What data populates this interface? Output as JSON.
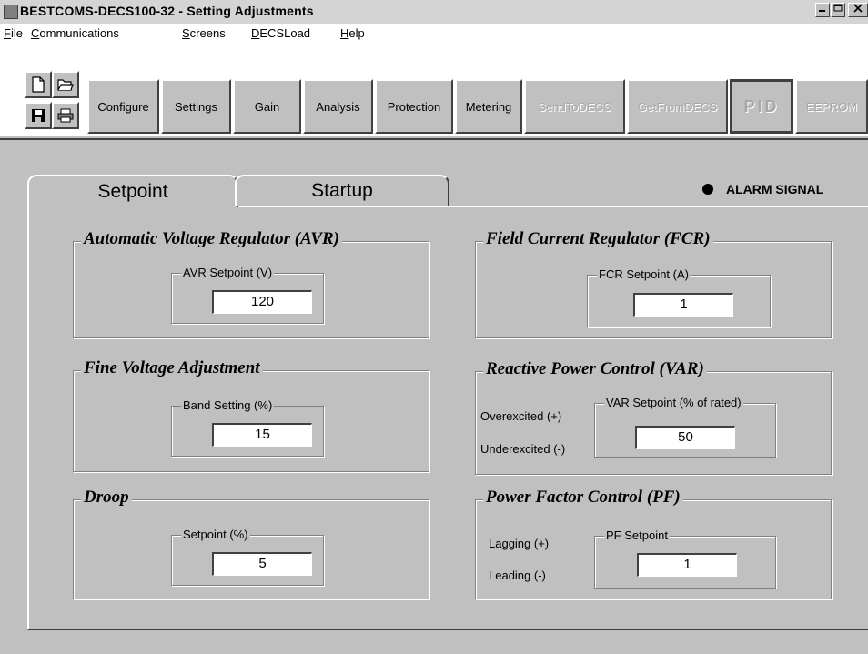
{
  "window": {
    "title": "BESTCOMS-DECS100-32 - Setting Adjustments"
  },
  "menu": [
    {
      "label": "File",
      "underline": "F",
      "rest": "ile"
    },
    {
      "label": "Communications",
      "underline": "C",
      "rest": "ommunications"
    },
    {
      "label": "Screens",
      "underline": "S",
      "rest": "creens"
    },
    {
      "label": "DECSLoad",
      "underline": "D",
      "rest": "ECSLoad"
    },
    {
      "label": "Help",
      "underline": "H",
      "rest": "elp"
    }
  ],
  "toolbar": {
    "configure": "Configure",
    "settings": "Settings",
    "gain": "Gain",
    "analysis": "Analysis",
    "protection": "Protection",
    "metering": "Metering",
    "send": "SendToDECS",
    "get": "GetFromDECS",
    "pid": "PID",
    "eeprom": "EEPROM"
  },
  "tabs": {
    "setpoint": "Setpoint",
    "startup": "Startup"
  },
  "alarm": "ALARM SIGNAL",
  "avr": {
    "title": "Automatic Voltage Regulator (AVR)",
    "sub": "AVR Setpoint (V)",
    "value": "120"
  },
  "fcr": {
    "title": "Field Current Regulator (FCR)",
    "sub": "FCR Setpoint (A)",
    "value": "1"
  },
  "fine": {
    "title": "Fine Voltage Adjustment",
    "sub": "Band Setting (%)",
    "value": "15"
  },
  "var": {
    "title": "Reactive Power Control (VAR)",
    "sub": "VAR Setpoint (% of rated)",
    "value": "50",
    "over": "Overexcited (+)",
    "under": "Underexcited (-)"
  },
  "droop": {
    "title": "Droop",
    "sub": "Setpoint (%)",
    "value": "5"
  },
  "pf": {
    "title": "Power Factor Control (PF)",
    "sub": "PF Setpoint",
    "value": "1",
    "lag": "Lagging (+)",
    "lead": "Leading (-)"
  }
}
